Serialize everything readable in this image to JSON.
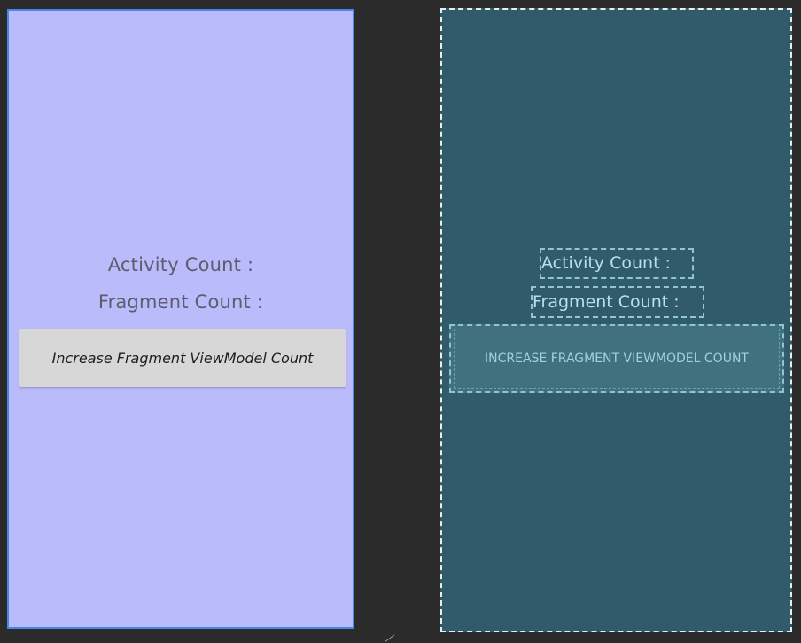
{
  "design_preview": {
    "activity_count_label": "Activity Count  :",
    "fragment_count_label": "Fragment Count  :",
    "button_label": "Increase Fragment ViewModel Count"
  },
  "blueprint_preview": {
    "activity_count_label": "Activity Count  :",
    "fragment_count_label": "Fragment Count  :",
    "button_label": "INCREASE FRAGMENT VIEWMODEL COUNT"
  },
  "colors": {
    "workspace_background": "#2b2b2b",
    "design_background": "#babbfb",
    "design_selection_border": "#4a86e8",
    "blueprint_background": "#315a6b",
    "blueprint_outline": "#8cc7d6"
  },
  "icons": {
    "resize_handle": "resize-handle-icon"
  }
}
